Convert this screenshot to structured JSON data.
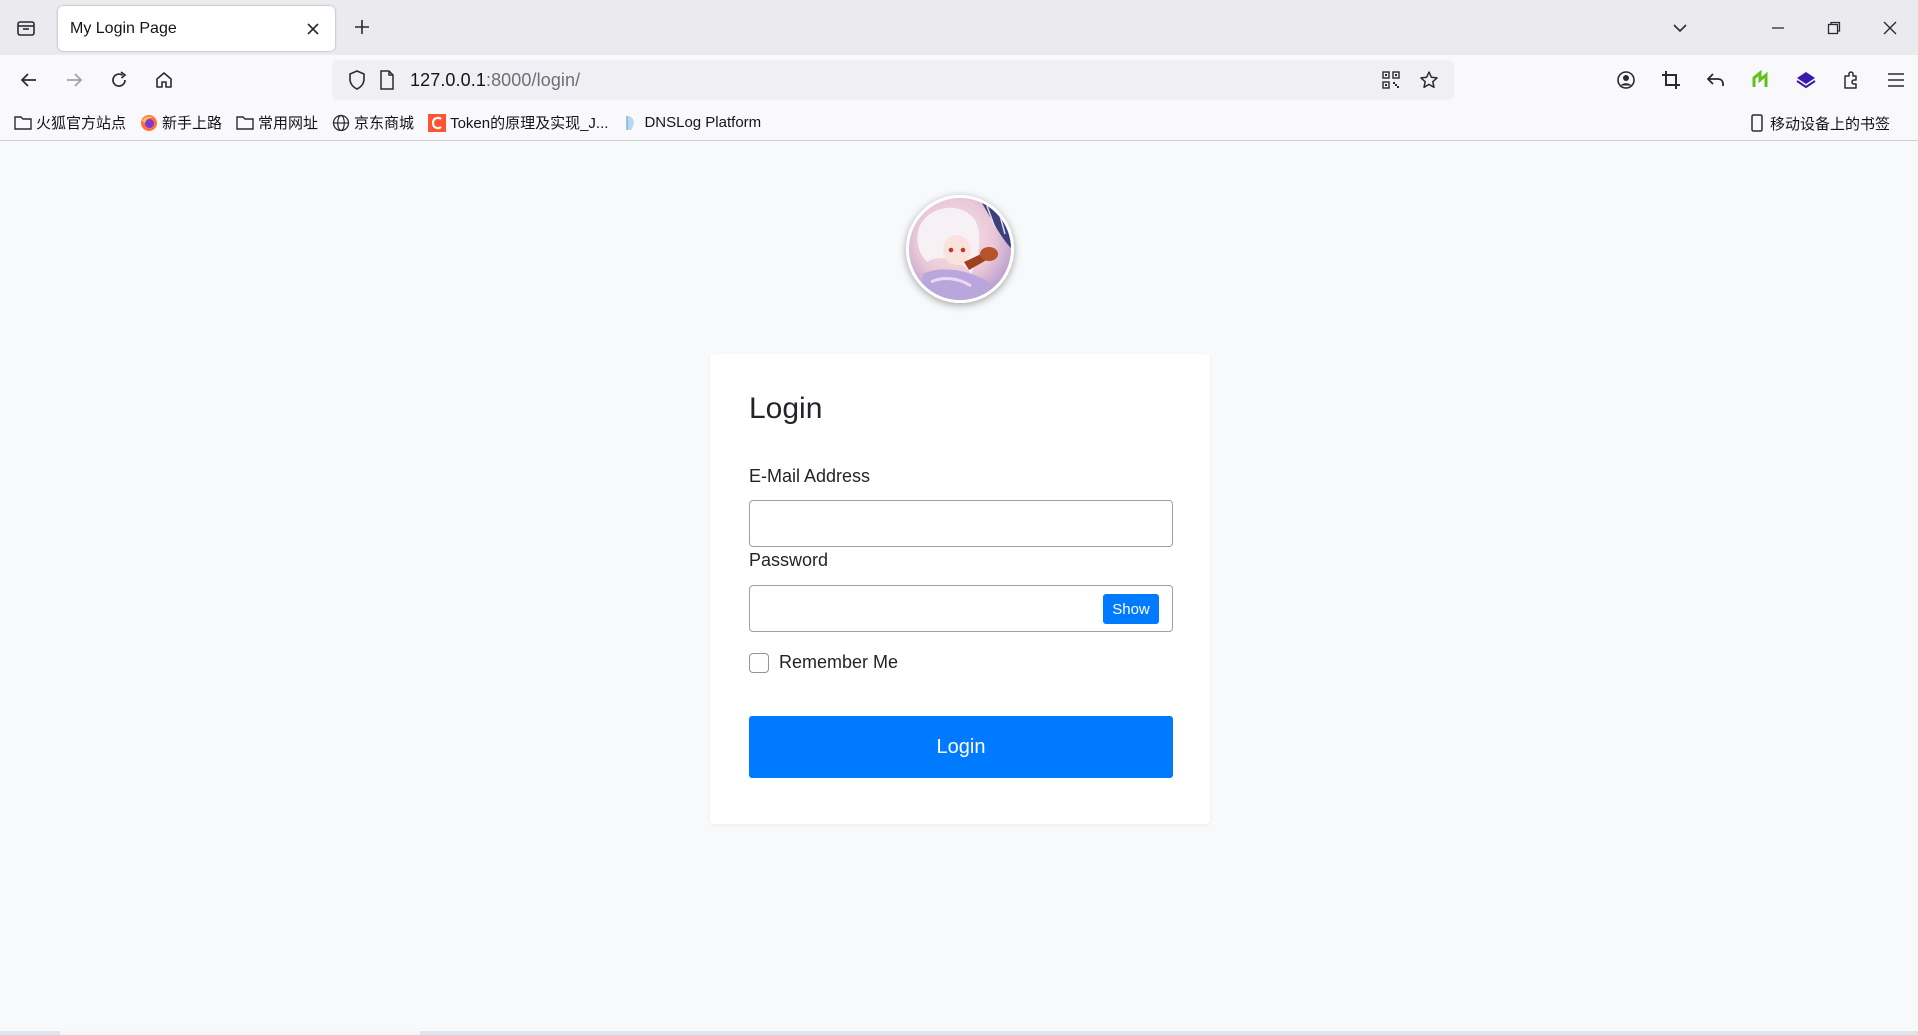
{
  "browser": {
    "tab": {
      "title": "My Login Page"
    },
    "url": {
      "host": "127.0.0.1",
      "path": ":8000/login/"
    },
    "bookmarks": [
      {
        "label": "火狐官方站点",
        "icon": "folder-icon"
      },
      {
        "label": "新手上路",
        "icon": "firefox-icon"
      },
      {
        "label": "常用网址",
        "icon": "folder-icon"
      },
      {
        "label": "京东商城",
        "icon": "globe-icon"
      },
      {
        "label": "Token的原理及实现_J...",
        "icon": "csdn-icon"
      },
      {
        "label": "DNSLog Platform",
        "icon": "dnslog-icon"
      }
    ],
    "mobile_bookmarks": "移动设备上的书签"
  },
  "login": {
    "title": "Login",
    "email_label": "E-Mail Address",
    "email_value": "",
    "password_label": "Password",
    "password_value": "",
    "show_label": "Show",
    "remember_label": "Remember Me",
    "remember_checked": false,
    "submit_label": "Login"
  },
  "colors": {
    "primary": "#007bff",
    "page_bg": "#f8f9fb",
    "card_bg": "#ffffff"
  }
}
